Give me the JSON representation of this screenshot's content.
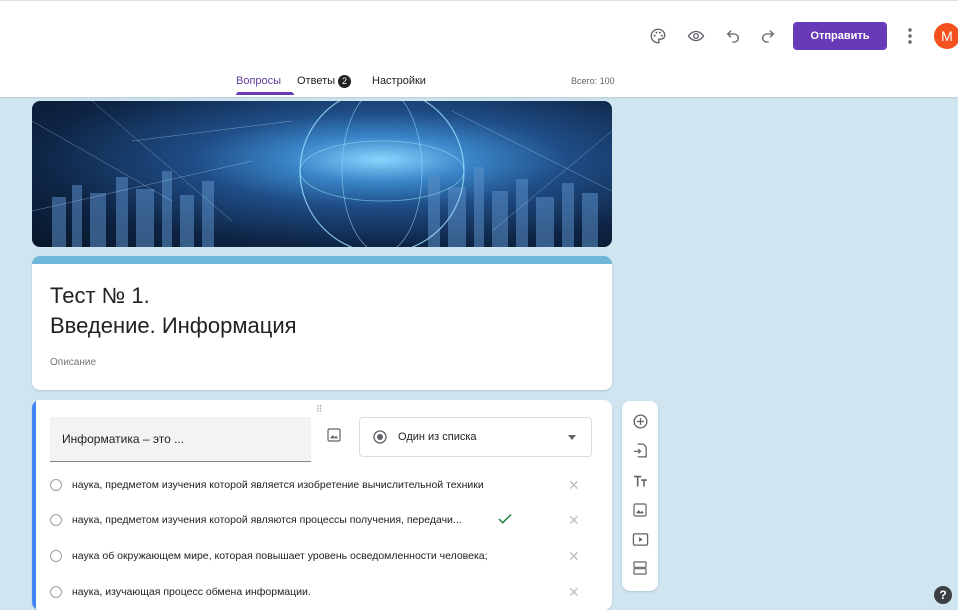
{
  "toolbar": {
    "icons": [
      "palette-icon",
      "eye-icon",
      "undo-icon",
      "redo-icon",
      "more-vert-icon"
    ],
    "send_label": "Отправить",
    "avatar_letter": "M",
    "avatar_color": "#f4511e",
    "accent_color": "#673ab7"
  },
  "tabs": [
    {
      "label": "Вопросы",
      "active": true
    },
    {
      "label": "Ответы",
      "badge": "2"
    },
    {
      "label": "Настройки"
    }
  ],
  "total_points": "Всего: 100",
  "form": {
    "title": "Тест № 1.\nВведение. Информация",
    "description": "Описание"
  },
  "question": {
    "title": "Информатика – это ...",
    "type": "Один из списка",
    "options": [
      {
        "text": "наука, предметом изучения которой является изобретение вычислительной техники",
        "correct": false
      },
      {
        "text": "наука, предметом изучения которой являются процессы получения, передачи...",
        "correct": true
      },
      {
        "text": "наука об окружающем мире, которая повышает уровень осведомленности человека;",
        "correct": false
      },
      {
        "text": "наука, изучающая процесс обмена информации.",
        "correct": false
      }
    ]
  },
  "side_tools": [
    "add-question-icon",
    "import-questions-icon",
    "title-text-icon",
    "image-icon",
    "video-icon",
    "section-icon"
  ],
  "help_label": "?"
}
